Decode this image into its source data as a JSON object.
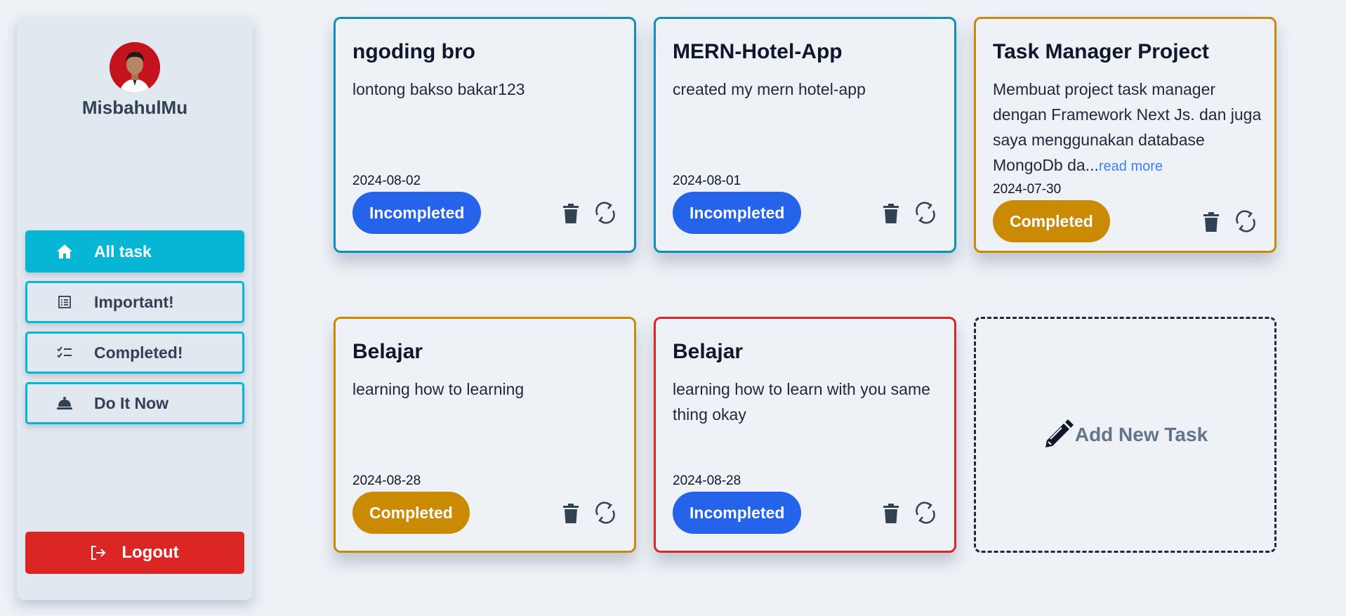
{
  "sidebar": {
    "username": "MisbahulMu",
    "nav": [
      {
        "label": "All task",
        "icon": "home-icon",
        "active": true
      },
      {
        "label": "Important!",
        "icon": "list-icon",
        "active": false
      },
      {
        "label": "Completed!",
        "icon": "checklist-icon",
        "active": false
      },
      {
        "label": "Do It Now",
        "icon": "bell-icon",
        "active": false
      }
    ],
    "logout_label": "Logout"
  },
  "tasks": [
    {
      "title": "ngoding bro",
      "description": "lontong bakso bakar123",
      "read_more": "",
      "date": "2024-08-02",
      "status": "Incompleted",
      "border_color": "#0e8fb5"
    },
    {
      "title": "MERN-Hotel-App",
      "description": "created my mern hotel-app",
      "read_more": "",
      "date": "2024-08-01",
      "status": "Incompleted",
      "border_color": "#0e8fb5"
    },
    {
      "title": "Task Manager Project",
      "description": "Membuat project task manager dengan Framework Next Js. dan juga saya menggunakan database MongoDb da...",
      "read_more": "read more",
      "date": "2024-07-30",
      "status": "Completed",
      "border_color": "#ca8a04"
    },
    {
      "title": "Belajar",
      "description": "learning how to learning",
      "read_more": "",
      "date": "2024-08-28",
      "status": "Completed",
      "border_color": "#ca8a04"
    },
    {
      "title": "Belajar",
      "description": "learning how to learn with you same thing okay",
      "read_more": "",
      "date": "2024-08-28",
      "status": "Incompleted",
      "border_color": "#dc2626"
    }
  ],
  "add_task_label": "Add New Task",
  "colors": {
    "accent": "#06b6d4",
    "incomplete": "#2563eb",
    "complete": "#ca8a04",
    "danger": "#dc2626"
  }
}
